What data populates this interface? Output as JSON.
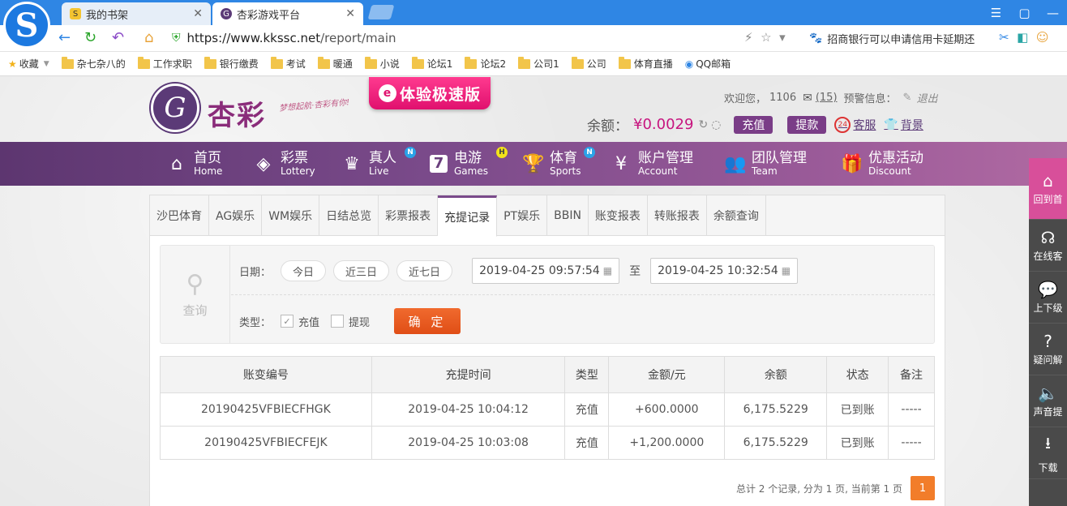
{
  "browser": {
    "tabs": [
      {
        "title": "我的书架",
        "active": false
      },
      {
        "title": "杏彩游戏平台",
        "active": true
      }
    ],
    "url_host": "https://www.kkssc.net",
    "url_path": "/report/main",
    "search_text": "招商银行可以申请信用卡延期还",
    "bookmarks": [
      "收藏",
      "杂七杂八的",
      "工作求职",
      "银行缴费",
      "考试",
      "暖通",
      "小说",
      "论坛1",
      "论坛2",
      "公司1",
      "公司",
      "体育直播",
      "QQ邮箱"
    ]
  },
  "header": {
    "logo_text": "杏彩",
    "slogan": "梦想起航·杏彩有你!",
    "promo": "体验极速版",
    "welcome": "欢迎您，",
    "user_id": "1106",
    "mail_count": "(15)",
    "alert_label": "预警信息：",
    "logout": "退出",
    "balance_label": "余额：",
    "balance_value": "¥0.0029",
    "recharge": "充值",
    "withdraw": "提款",
    "service": "客服",
    "background": "背景"
  },
  "nav": [
    {
      "cn": "首页",
      "en": "Home",
      "icon": "home-icon",
      "badge": ""
    },
    {
      "cn": "彩票",
      "en": "Lottery",
      "icon": "lottery-icon",
      "badge": ""
    },
    {
      "cn": "真人",
      "en": "Live",
      "icon": "live-dealer-icon",
      "badge": "N"
    },
    {
      "cn": "电游",
      "en": "Games",
      "icon": "slot-seven-icon",
      "badge": "H"
    },
    {
      "cn": "体育",
      "en": "Sports",
      "icon": "trophy-icon",
      "badge": "N"
    },
    {
      "cn": "账户管理",
      "en": "Account",
      "icon": "yen-coin-icon",
      "badge": ""
    },
    {
      "cn": "团队管理",
      "en": "Team",
      "icon": "team-icon",
      "badge": ""
    },
    {
      "cn": "优惠活动",
      "en": "Discount",
      "icon": "gift-icon",
      "badge": ""
    }
  ],
  "sidebar": [
    "回到首",
    "在线客",
    "上下级",
    "疑问解",
    "声音提",
    "下载"
  ],
  "report_tabs": [
    "沙巴体育",
    "AG娱乐",
    "WM娱乐",
    "日结总览",
    "彩票报表",
    "充提记录",
    "PT娱乐",
    "BBIN",
    "账变报表",
    "转账报表",
    "余额查询"
  ],
  "active_tab": "充提记录",
  "query": {
    "side_label": "查询",
    "date_label": "日期：",
    "quick": [
      "今日",
      "近三日",
      "近七日"
    ],
    "start": "2019-04-25 09:57:54",
    "to": "至",
    "end": "2019-04-25 10:32:54",
    "type_label": "类型：",
    "types": [
      {
        "label": "充值",
        "checked": true
      },
      {
        "label": "提现",
        "checked": false
      }
    ],
    "confirm": "确 定"
  },
  "table": {
    "headers": [
      "账变编号",
      "充提时间",
      "类型",
      "金额/元",
      "余额",
      "状态",
      "备注"
    ],
    "rows": [
      [
        "20190425VFBIECFHGK",
        "2019-04-25 10:04:12",
        "充值",
        "+600.0000",
        "6,175.5229",
        "已到账",
        "-----"
      ],
      [
        "20190425VFBIECFEJK",
        "2019-04-25 10:03:08",
        "充值",
        "+1,200.0000",
        "6,175.5229",
        "已到账",
        "-----"
      ]
    ]
  },
  "pager": {
    "summary": "总计 2 个记录, 分为 1 页, 当前第 1 页",
    "current": "1"
  },
  "colors": {
    "brand_purple": "#7a4a8a",
    "accent_pink": "#c7157f",
    "confirm_orange": "#e04e16",
    "amount_red": "#c9232b",
    "status_green": "#2f9a2f"
  }
}
